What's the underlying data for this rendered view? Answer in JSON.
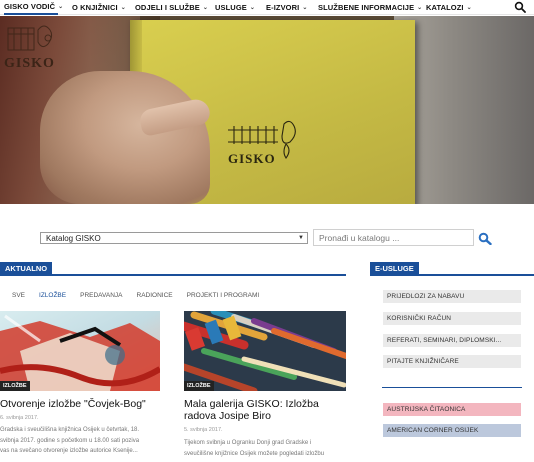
{
  "nav": {
    "items": [
      {
        "label": "GISKO VODIČ",
        "chevron": true
      },
      {
        "label": "O KNJIŽNICI",
        "chevron": true
      },
      {
        "label": "ODJELI I SLUŽBE",
        "chevron": true
      },
      {
        "label": "USLUGE",
        "chevron": true
      },
      {
        "label": "E-IZVORI",
        "chevron": true
      },
      {
        "label": "SLUŽBENE INFORMACIJE",
        "chevron": true
      },
      {
        "label": "KATALOZI",
        "chevron": true
      }
    ],
    "search_icon": "search-icon"
  },
  "hero": {
    "logo_text": "GISKO",
    "book_stamp_text": "GISKO"
  },
  "catalog": {
    "select_value": "Katalog GISKO",
    "search_placeholder": "Pronađi u katalogu ..."
  },
  "aktualno": {
    "title": "AKTUALNO",
    "tabs": [
      "SVE",
      "IZLOŽBE",
      "PREDAVANJA",
      "RADIONICE",
      "PROJEKTI I PROGRAMI"
    ],
    "active_tab": "IZLOŽBE",
    "articles": [
      {
        "category": "IZLOŽBE",
        "title_line1": "Otvorenje izložbe \"Čovjek-Bog\"",
        "date": "6. svibnja 2017.",
        "excerpt": [
          "Gradska i sveučilišna knjižnica Osijek u četvrtak, 18.",
          "svibnja 2017. godine s početkom u 18.00 sati poziva",
          "vas na svečano otvorenje izložbe autorice Ksenije..."
        ]
      },
      {
        "category": "IZLOŽBE",
        "title_line1": "Mala galerija GISKO: Izložba",
        "title_line2": "radova Josipe Biro",
        "date": "5. svibnja 2017.",
        "excerpt": [
          "Tijekom svibnja u Ogranku Donji grad Gradske i",
          "sveučilišne knjižnice Osijek možete pogledati izložbu"
        ]
      }
    ]
  },
  "eusluge": {
    "title": "E-USLUGE",
    "items": [
      "PRIJEDLOZI ZA NABAVU",
      "KORISNIČKI RAČUN",
      "REFERATI, SEMINARI, DIPLOMSKI...",
      "PITAJTE KNJIŽNIČARE"
    ],
    "links": [
      {
        "label": "AUSTRIJSKA ČITAONICA",
        "color": "#f3b6bf"
      },
      {
        "label": "AMERICAN CORNER OSIJEK",
        "color": "#bcc8dc"
      }
    ]
  },
  "colors": {
    "accent": "#1a4f99"
  }
}
